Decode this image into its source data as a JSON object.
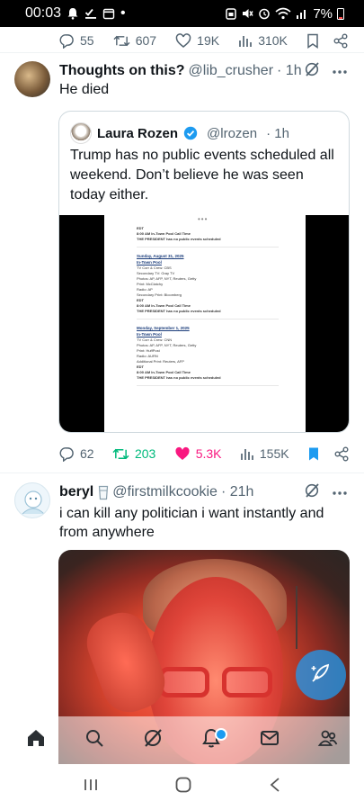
{
  "status_bar": {
    "time": "00:03",
    "battery": "7%",
    "dot": "•"
  },
  "top_tweet_actions": {
    "replies": "55",
    "retweets": "607",
    "likes": "19K",
    "views": "310K"
  },
  "tweet1": {
    "display_name": "Thoughts on this?",
    "handle": "@lib_crusher",
    "time": "· 1h",
    "text": "He died",
    "quote": {
      "display_name": "Laura Rozen",
      "handle": "@lrozen",
      "time": "· 1h",
      "text": "Trump has no public events scheduled all weekend. Don’t believe he was seen today either.",
      "document_lines": [
        {
          "t": "EDT",
          "k": "b"
        },
        {
          "t": "8:00 AM          In-Town Pool Call Time",
          "k": "b"
        },
        {
          "t": "THE PRESIDENT has no public events scheduled",
          "k": "b"
        },
        {
          "t": "Sunday, August 31, 2025",
          "k": "hdr"
        },
        {
          "t": "In-Town Pool",
          "k": "hdr"
        },
        {
          "t": "TV Corr & Crew: CBS",
          "k": ""
        },
        {
          "t": "Secondary TV: Gray TV",
          "k": ""
        },
        {
          "t": "Photos: AP, AFP, NYT, Reuters, Getty",
          "k": ""
        },
        {
          "t": "Print: McClatchy",
          "k": ""
        },
        {
          "t": "Radio: AP",
          "k": ""
        },
        {
          "t": "Secondary Print: Bloomberg",
          "k": ""
        },
        {
          "t": "EDT",
          "k": "b"
        },
        {
          "t": "8:00 AM          In-Town Pool Call Time",
          "k": "b"
        },
        {
          "t": "THE PRESIDENT has no public events scheduled",
          "k": "b"
        },
        {
          "t": "Monday, September 1, 2025",
          "k": "hdr"
        },
        {
          "t": "In-Town Pool",
          "k": "hdr"
        },
        {
          "t": "TV Corr & Crew: CNN",
          "k": ""
        },
        {
          "t": "Photos: AP, AFP, NYT, Reuters, Getty",
          "k": ""
        },
        {
          "t": "Print: HuffPost",
          "k": ""
        },
        {
          "t": "Radio: AURN",
          "k": ""
        },
        {
          "t": "Additional Print: Reuters, AFP",
          "k": ""
        },
        {
          "t": "EDT",
          "k": "b"
        },
        {
          "t": "8:00 AM          In-Town Pool Call Time",
          "k": "b"
        },
        {
          "t": "THE PRESIDENT has no public events scheduled",
          "k": "b"
        }
      ]
    },
    "actions": {
      "replies": "62",
      "retweets": "203",
      "likes": "5.3K",
      "views": "155K"
    }
  },
  "tweet2": {
    "display_name": "beryl",
    "handle": "@firstmilkcookie",
    "time": "· 21h",
    "text": "i can kill any politician i want instantly and from anywhere"
  },
  "icons": {
    "reply": "reply-icon",
    "retweet": "retweet-icon",
    "like": "heart-icon",
    "views": "views-icon",
    "bookmark": "bookmark-icon",
    "share": "share-icon",
    "grok": "grok-icon",
    "more": "more-icon"
  },
  "colors": {
    "accent": "#1d9bf0",
    "retweet_active": "#00ba7c",
    "like_active": "#f91880",
    "muted": "#536471"
  }
}
